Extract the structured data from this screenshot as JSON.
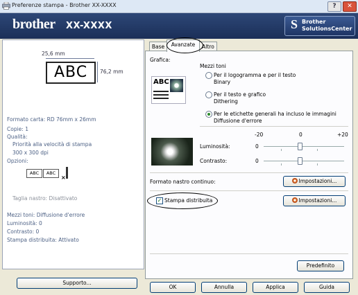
{
  "window": {
    "title": "Preferenze stampa - Brother XX-XXXX",
    "help_label": "?",
    "close_label": "✕"
  },
  "brand": {
    "logo": "brother",
    "model": "XX-XXXX",
    "solutions_line1": "Brother",
    "solutions_line2": "SolutionsCenter"
  },
  "preview": {
    "width_label": "25,6 mm",
    "height_label": "76,2 mm",
    "sample_text": "ABC",
    "mini_text": "ABC"
  },
  "info": {
    "paper_format": "Formato carta: RD 76mm x 26mm",
    "copies": "Copie: 1",
    "quality_label": "Qualità:",
    "quality_value": "Priorità alla velocità di stampa",
    "resolution": "300 x 300 dpi",
    "options_label": "Opzioni:",
    "cutting": "Taglia nastro: Disattivato",
    "halftone": "Mezzi toni: Diffusione d'errore",
    "brightness": "Luminosità:  0",
    "contrast": "Contrasto:  0",
    "distributed": "Stampa distribuita: Attivato"
  },
  "tabs": [
    {
      "label": "Base"
    },
    {
      "label": "Avanzate"
    },
    {
      "label": "Altro"
    }
  ],
  "advanced": {
    "graphics_label": "Grafica:",
    "halftone_label": "Mezzi toni",
    "option1_line1": "Per il logogramma e per il testo",
    "option1_line2": "Binary",
    "option2_line1": "Per il testo e grafico",
    "option2_line2": "Dithering",
    "option3_line1": "Per le etichette generali ha incluso le immagini",
    "option3_line2": "Diffusione d'errore",
    "selected_option": 3,
    "scale_min": "-20",
    "scale_mid": "0",
    "scale_max": "+20",
    "brightness_label": "Luminosità:",
    "brightness_value": "0",
    "contrast_label": "Contrasto:",
    "contrast_value": "0",
    "continuous_tape_label": "Formato nastro continuo:",
    "settings_label": "Impostazioni...",
    "distributed_label": "Stampa distribuita",
    "distributed_checked": true,
    "default_label": "Predefinito",
    "graphic_icon_text": "ABC"
  },
  "footer": {
    "support_label": "Supporto...",
    "ok_label": "OK",
    "cancel_label": "Annulla",
    "apply_label": "Applica",
    "help_label": "Guida"
  }
}
